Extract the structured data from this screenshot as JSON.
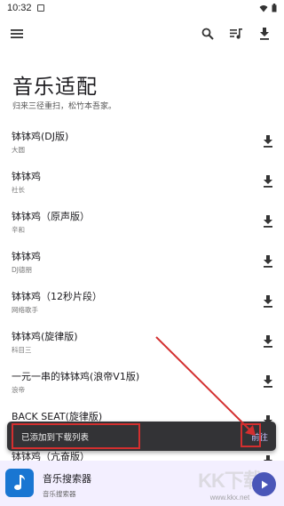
{
  "status_bar": {
    "time": "10:32"
  },
  "app_bar": {
    "icons": [
      "menu-icon",
      "search-icon",
      "queue-music-icon",
      "download-icon"
    ]
  },
  "header": {
    "title": "音乐适配",
    "subtitle": "归来三径重扫，松竹本吾家。"
  },
  "songs": [
    {
      "title": "钵钵鸡(DJ版)",
      "artist": "大圆"
    },
    {
      "title": "钵钵鸡",
      "artist": "社长"
    },
    {
      "title": "钵钵鸡（原声版）",
      "artist": "辛和"
    },
    {
      "title": "钵钵鸡",
      "artist": "DJ德朋"
    },
    {
      "title": "钵钵鸡（12秒片段）",
      "artist": "网络歌手"
    },
    {
      "title": "钵钵鸡(旋律版)",
      "artist": "科目三"
    },
    {
      "title": "一元一串的钵钵鸡(浪帝V1版)",
      "artist": "浪帝"
    },
    {
      "title": "BACK SEAT(旋律版)",
      "artist": ""
    },
    {
      "title": "钵钵鸡（亢奋版）",
      "artist": ""
    }
  ],
  "snackbar": {
    "message": "已添加到下载列表",
    "action": "前往"
  },
  "player": {
    "title": "音乐搜索器",
    "subtitle": "音乐搜索器"
  },
  "watermark": {
    "mark": "KK下载",
    "url": "www.kkx.net"
  },
  "colors": {
    "accent": "#4a56b8",
    "player_bg": "#f3efff",
    "app_icon": "#1976d2",
    "snackbar_bg": "#333336",
    "annotation_red": "#d32f2f"
  }
}
